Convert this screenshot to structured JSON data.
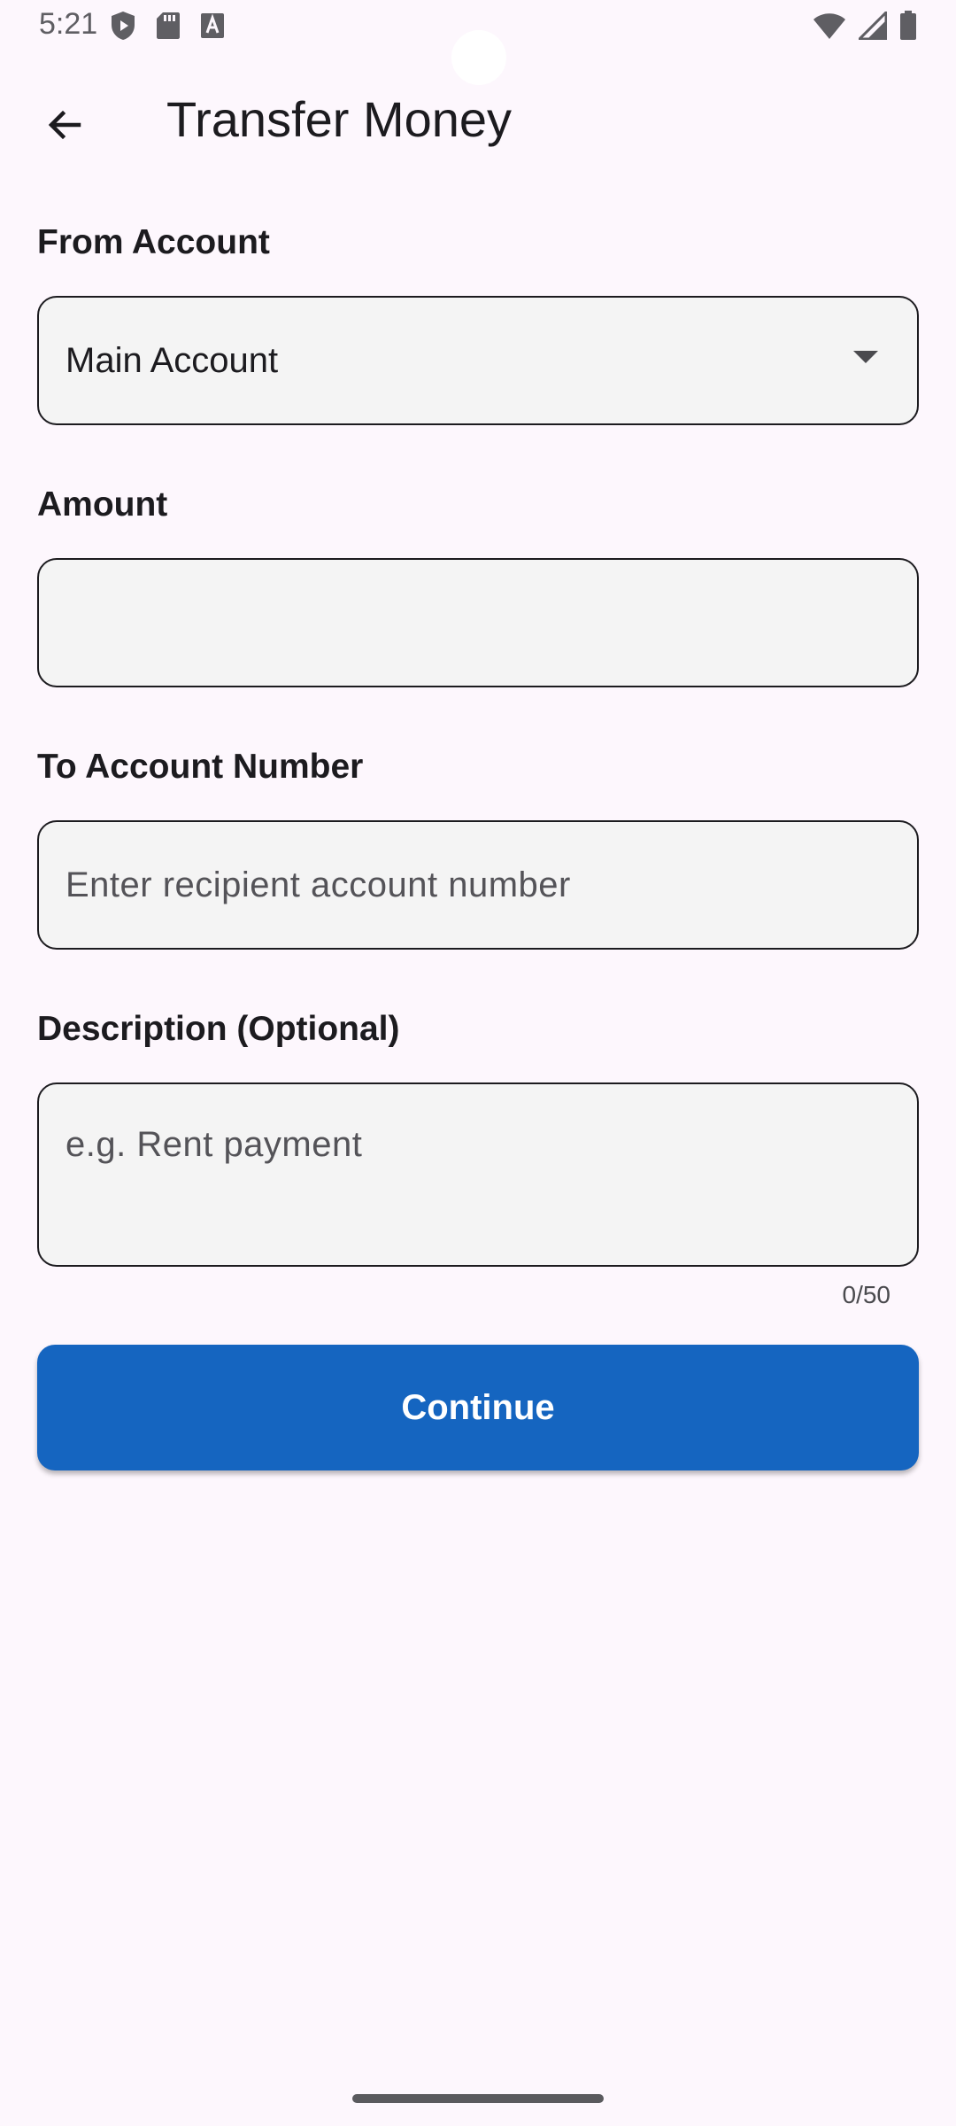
{
  "status_bar": {
    "time": "5:21",
    "left_icons": [
      "shield-play-icon",
      "sd-card-icon",
      "font-a-icon"
    ],
    "right_icons": [
      "wifi-icon",
      "cell-signal-icon",
      "battery-icon"
    ]
  },
  "app_bar": {
    "title": "Transfer Money",
    "back_icon": "arrow-back-icon"
  },
  "form": {
    "from_account": {
      "label": "From Account",
      "selected_value": "Main Account"
    },
    "amount": {
      "label": "Amount",
      "value": ""
    },
    "to_account": {
      "label": "To Account Number",
      "placeholder": "Enter recipient account number"
    },
    "description": {
      "label": "Description (Optional)",
      "placeholder": "e.g. Rent payment",
      "counter": "0/50"
    }
  },
  "actions": {
    "continue_label": "Continue"
  },
  "colors": {
    "background": "#fdf7fd",
    "primary_button": "#1565c0",
    "field_fill": "#f4f4f4"
  }
}
